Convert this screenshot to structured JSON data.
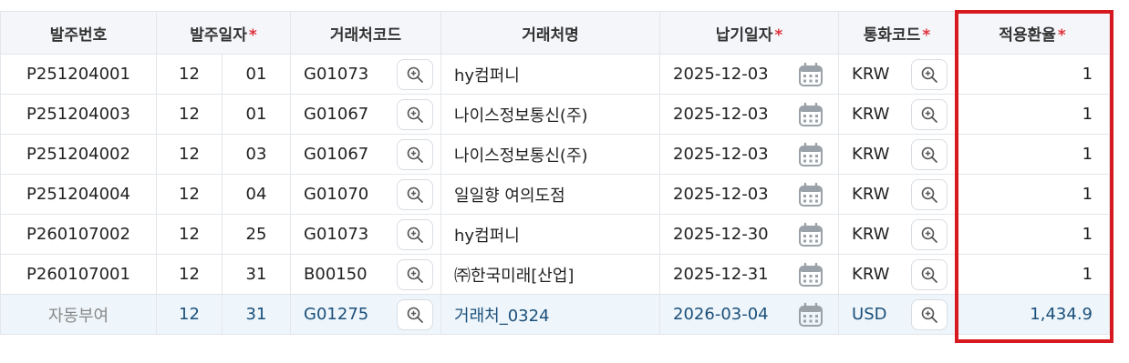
{
  "columns": [
    {
      "label": "발주번호",
      "required": false
    },
    {
      "label": "발주일자",
      "required": true
    },
    {
      "label": "거래처코드",
      "required": false
    },
    {
      "label": "거래처명",
      "required": false
    },
    {
      "label": "납기일자",
      "required": true
    },
    {
      "label": "통화코드",
      "required": true
    },
    {
      "label": "적용환율",
      "required": true
    }
  ],
  "required_mark": "*",
  "rows": [
    {
      "po_no": "P251204001",
      "month": "12",
      "day": "01",
      "vendor_code": "G01073",
      "vendor_name": "hy컴퍼니",
      "due_date": "2025-12-03",
      "currency": "KRW",
      "rate": "1"
    },
    {
      "po_no": "P251204003",
      "month": "12",
      "day": "01",
      "vendor_code": "G01067",
      "vendor_name": "나이스정보통신(주)",
      "due_date": "2025-12-03",
      "currency": "KRW",
      "rate": "1"
    },
    {
      "po_no": "P251204002",
      "month": "12",
      "day": "03",
      "vendor_code": "G01067",
      "vendor_name": "나이스정보통신(주)",
      "due_date": "2025-12-03",
      "currency": "KRW",
      "rate": "1"
    },
    {
      "po_no": "P251204004",
      "month": "12",
      "day": "04",
      "vendor_code": "G01070",
      "vendor_name": "일일향 여의도점",
      "due_date": "2025-12-03",
      "currency": "KRW",
      "rate": "1"
    },
    {
      "po_no": "P260107002",
      "month": "12",
      "day": "25",
      "vendor_code": "G01073",
      "vendor_name": "hy컴퍼니",
      "due_date": "2025-12-30",
      "currency": "KRW",
      "rate": "1"
    },
    {
      "po_no": "P260107001",
      "month": "12",
      "day": "31",
      "vendor_code": "B00150",
      "vendor_name": "㈜한국미래[산업]",
      "due_date": "2025-12-31",
      "currency": "KRW",
      "rate": "1"
    }
  ],
  "new_row": {
    "po_no": "자동부여",
    "month": "12",
    "day": "31",
    "vendor_code": "G01275",
    "vendor_name": "거래처_0324",
    "due_date": "2026-03-04",
    "currency": "USD",
    "rate": "1,434.9"
  },
  "icons": {
    "lookup": "magnifier-plus-icon",
    "date": "calendar-icon"
  },
  "colors": {
    "highlight": "#d71920",
    "required": "#e0313b",
    "header_bg": "#f4f6f9",
    "new_row_bg": "#eef6fb"
  }
}
